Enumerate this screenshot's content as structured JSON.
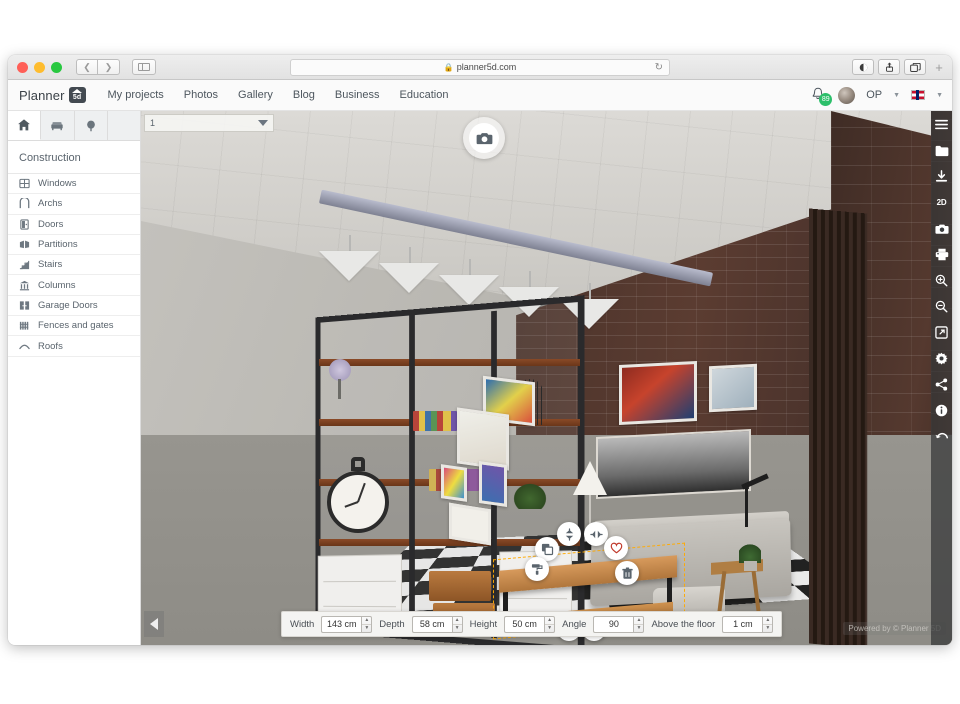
{
  "browser": {
    "url": "planner5d.com",
    "lock_icon": "lock-icon",
    "reload_icon": "reload-icon",
    "back_icon": "chevron-left-icon",
    "forward_icon": "chevron-right-icon",
    "sidebar_icon": "sidebar-toggle-icon",
    "reader_icon": "reader-view-icon",
    "share_icon": "share-icon",
    "tabs_icon": "show-tabs-icon",
    "new_tab_label": "+"
  },
  "site_header": {
    "logo_word": "Planner",
    "logo_mark": "5d",
    "nav": [
      {
        "label": "My projects"
      },
      {
        "label": "Photos"
      },
      {
        "label": "Gallery"
      },
      {
        "label": "Blog"
      },
      {
        "label": "Business"
      },
      {
        "label": "Education"
      }
    ],
    "notifications": {
      "icon": "bell-icon",
      "count": "89"
    },
    "user": {
      "name": "OP",
      "avatar": "user-avatar",
      "chevron": "chevron-down-icon"
    },
    "language": {
      "flag": "uk-flag-icon",
      "chevron": "chevron-down-icon"
    }
  },
  "left_panel": {
    "tabs": [
      {
        "name": "construction",
        "icon": "home-icon",
        "active": true
      },
      {
        "name": "furniture",
        "icon": "sofa-icon",
        "active": false
      },
      {
        "name": "outdoor",
        "icon": "tree-icon",
        "active": false
      },
      {
        "name": "extra",
        "icon": "blank-icon",
        "active": false
      }
    ],
    "title": "Construction",
    "categories": [
      {
        "label": "Windows",
        "icon": "window-icon"
      },
      {
        "label": "Archs",
        "icon": "arch-icon"
      },
      {
        "label": "Doors",
        "icon": "door-icon"
      },
      {
        "label": "Partitions",
        "icon": "partition-icon"
      },
      {
        "label": "Stairs",
        "icon": "stairs-icon"
      },
      {
        "label": "Columns",
        "icon": "column-icon"
      },
      {
        "label": "Garage Doors",
        "icon": "garage-door-icon"
      },
      {
        "label": "Fences and gates",
        "icon": "fence-icon"
      },
      {
        "label": "Roofs",
        "icon": "roof-icon"
      }
    ]
  },
  "viewport": {
    "floor_selector": {
      "value": "1",
      "chevron": "triangle-down-icon"
    },
    "camera_button": {
      "icon": "camera-icon"
    },
    "collapse_button": {
      "icon": "triangle-left-icon"
    },
    "watermark": "Powered by © Planner 5D",
    "object_tools": [
      {
        "name": "duplicate",
        "icon": "copy-icon"
      },
      {
        "name": "flip-vertical",
        "icon": "flip-vertical-icon"
      },
      {
        "name": "flip-horizontal",
        "icon": "flip-horizontal-icon"
      },
      {
        "name": "favorite",
        "icon": "heart-icon"
      },
      {
        "name": "paint",
        "icon": "paint-roller-icon"
      },
      {
        "name": "delete",
        "icon": "trash-icon"
      },
      {
        "name": "move-vertical",
        "icon": "up-down-arrows-icon"
      },
      {
        "name": "rotate",
        "icon": "rotate-icon"
      }
    ]
  },
  "properties_bar": {
    "fields": [
      {
        "label": "Width",
        "value": "143 cm"
      },
      {
        "label": "Depth",
        "value": "58 cm"
      },
      {
        "label": "Height",
        "value": "50 cm"
      },
      {
        "label": "Angle",
        "value": "90"
      },
      {
        "label": "Above the floor",
        "value": "1 cm"
      }
    ]
  },
  "right_toolbar": [
    {
      "name": "menu",
      "icon": "hamburger-menu-icon"
    },
    {
      "name": "projects",
      "icon": "folder-icon"
    },
    {
      "name": "download",
      "icon": "download-icon"
    },
    {
      "name": "view-2d",
      "icon": "2d-icon",
      "label": "2D"
    },
    {
      "name": "snapshot",
      "icon": "camera-icon"
    },
    {
      "name": "print",
      "icon": "printer-icon"
    },
    {
      "name": "zoom-in",
      "icon": "magnifier-plus-icon"
    },
    {
      "name": "zoom-out",
      "icon": "magnifier-minus-icon"
    },
    {
      "name": "fullscreen",
      "icon": "expand-icon"
    },
    {
      "name": "settings",
      "icon": "gear-icon"
    },
    {
      "name": "share",
      "icon": "share-nodes-icon"
    },
    {
      "name": "info",
      "icon": "info-icon"
    },
    {
      "name": "undo",
      "icon": "undo-arrow-icon"
    }
  ],
  "colors": {
    "accent_green": "#2cbf6a",
    "selection_orange": "#ffaa00",
    "toolbar_dark": "#343638",
    "text_gray": "#5a646d"
  }
}
